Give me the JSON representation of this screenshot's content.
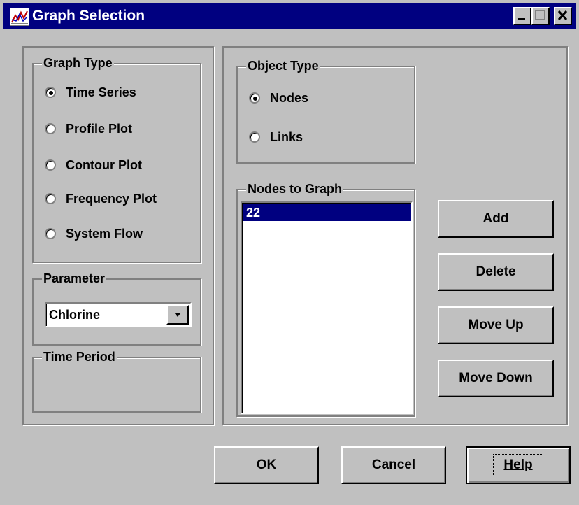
{
  "window": {
    "title": "Graph Selection"
  },
  "graph_type": {
    "label": "Graph Type",
    "options": [
      {
        "label": "Time Series",
        "selected": true
      },
      {
        "label": "Profile Plot",
        "selected": false
      },
      {
        "label": "Contour Plot",
        "selected": false
      },
      {
        "label": "Frequency Plot",
        "selected": false
      },
      {
        "label": "System Flow",
        "selected": false
      }
    ]
  },
  "parameter": {
    "label": "Parameter",
    "value": "Chlorine"
  },
  "time_period": {
    "label": "Time Period"
  },
  "object_type": {
    "label": "Object Type",
    "options": [
      {
        "label": "Nodes",
        "selected": true
      },
      {
        "label": "Links",
        "selected": false
      }
    ]
  },
  "nodes_to_graph": {
    "label": "Nodes to Graph",
    "items": [
      "22"
    ]
  },
  "side_buttons": {
    "add": "Add",
    "delete": "Delete",
    "move_up": "Move Up",
    "move_down": "Move Down"
  },
  "footer": {
    "ok": "OK",
    "cancel": "Cancel",
    "help": "Help"
  }
}
